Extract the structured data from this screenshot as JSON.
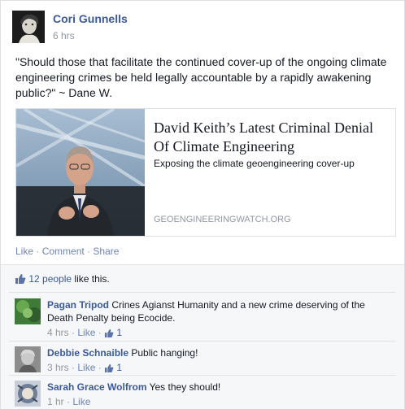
{
  "post": {
    "author": "Cori Gunnells",
    "time": "6 hrs",
    "text": "\"Should those that facilitate the continued cover-up of the ongoing climate engineering crimes be held legally accountable by a rapidly awakening public?\" ~ Dane W.",
    "link": {
      "title": "David Keith’s Latest Criminal Denial Of Climate Engineering",
      "description": "Exposing the climate geoengineering cover-up",
      "domain": "GEOENGINEERINGWATCH.ORG"
    },
    "actions": {
      "like": "Like",
      "comment": "Comment",
      "share": "Share",
      "separator": "·"
    }
  },
  "likes": {
    "people": "12 people",
    "suffix": " like this."
  },
  "comments": [
    {
      "name": "Pagan Tripod",
      "text": "Crines Agianst Humanity and a new crime deserving of the Death Penalty being Ecocide.",
      "time": "4 hrs",
      "like": "Like",
      "count": "1"
    },
    {
      "name": "Debbie Schnaible",
      "text": "Public hanging!",
      "time": "3 hrs",
      "like": "Like",
      "count": "1"
    },
    {
      "name": "Sarah Grace Wolfrom",
      "text": "Yes they should!",
      "time": "1 hr",
      "like": "Like",
      "count": ""
    }
  ],
  "colors": {
    "link": "#3b5998",
    "meta": "#9197a3",
    "ufi_bg": "#f6f7f8"
  }
}
